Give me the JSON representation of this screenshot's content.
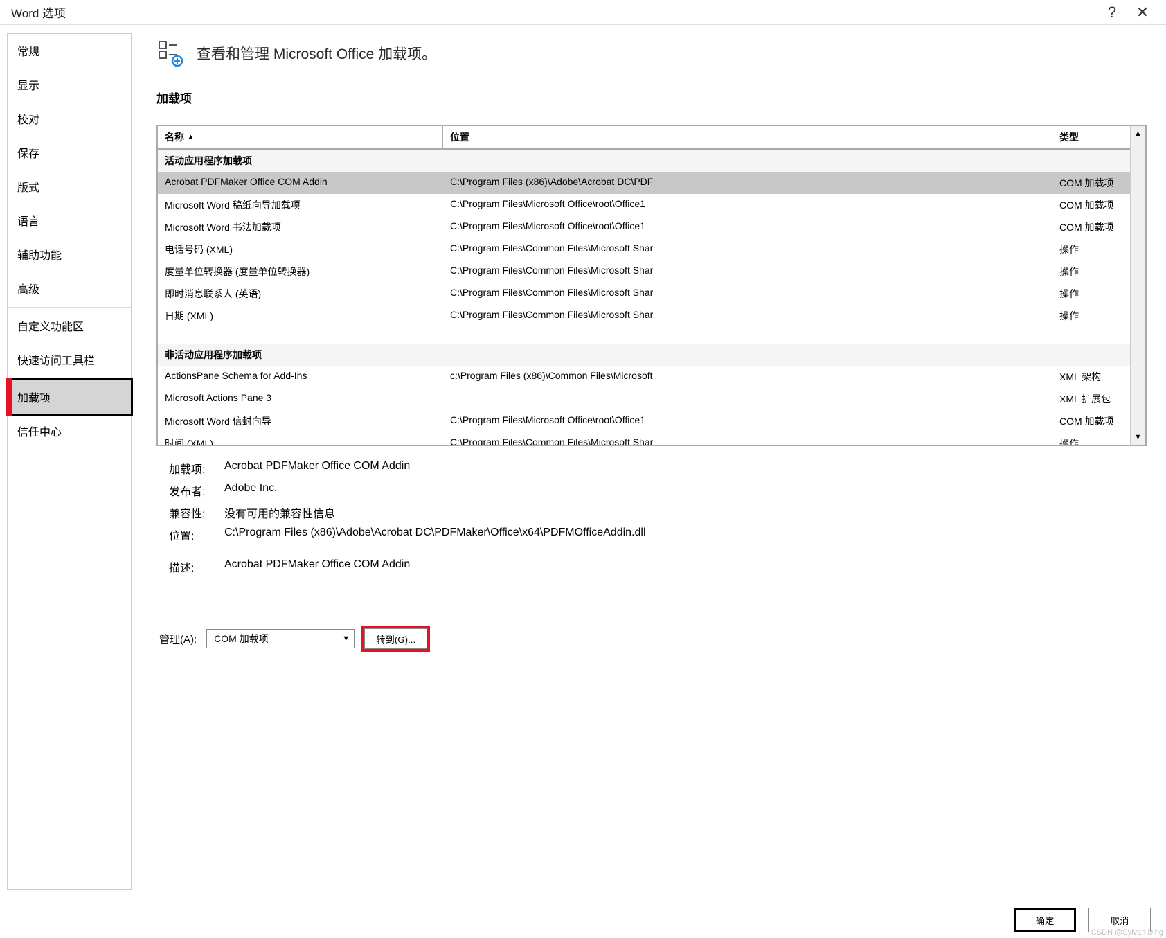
{
  "titlebar": {
    "title": "Word 选项",
    "help": "?",
    "close": "✕"
  },
  "sidebar": {
    "items": [
      "常规",
      "显示",
      "校对",
      "保存",
      "版式",
      "语言",
      "辅助功能",
      "高级"
    ],
    "items2": [
      "自定义功能区",
      "快速访问工具栏"
    ],
    "items3": [
      "加载项",
      "信任中心"
    ],
    "selected": "加载项"
  },
  "header": {
    "text": "查看和管理 Microsoft Office 加载项。"
  },
  "section_title": "加载项",
  "table": {
    "headers": {
      "name": "名称",
      "loc": "位置",
      "type": "类型"
    },
    "group1": "活动应用程序加载项",
    "group2": "非活动应用程序加载项",
    "rows1": [
      {
        "name": "Acrobat PDFMaker Office COM Addin",
        "loc": "C:\\Program Files (x86)\\Adobe\\Acrobat DC\\PDF",
        "type": "COM 加载项",
        "selected": true
      },
      {
        "name": "Microsoft Word 稿纸向导加载项",
        "loc": "C:\\Program Files\\Microsoft Office\\root\\Office1",
        "type": "COM 加载项"
      },
      {
        "name": "Microsoft Word 书法加载项",
        "loc": "C:\\Program Files\\Microsoft Office\\root\\Office1",
        "type": "COM 加载项"
      },
      {
        "name": "电话号码 (XML)",
        "loc": "C:\\Program Files\\Common Files\\Microsoft Shar",
        "type": "操作"
      },
      {
        "name": "度量单位转换器 (度量单位转换器)",
        "loc": "C:\\Program Files\\Common Files\\Microsoft Shar",
        "type": "操作"
      },
      {
        "name": "即时消息联系人 (英语)",
        "loc": "C:\\Program Files\\Common Files\\Microsoft Shar",
        "type": "操作"
      },
      {
        "name": "日期 (XML)",
        "loc": "C:\\Program Files\\Common Files\\Microsoft Shar",
        "type": "操作"
      }
    ],
    "rows2": [
      {
        "name": "ActionsPane Schema for Add-Ins",
        "loc": "c:\\Program Files (x86)\\Common Files\\Microsoft",
        "type": "XML 架构"
      },
      {
        "name": "Microsoft Actions Pane 3",
        "loc": "",
        "type": "XML 扩展包"
      },
      {
        "name": "Microsoft Word 信封向导",
        "loc": "C:\\Program Files\\Microsoft Office\\root\\Office1",
        "type": "COM 加载项"
      },
      {
        "name": "时间 (XML)",
        "loc": "C:\\Program Files\\Common Files\\Microsoft Shar",
        "type": "操作"
      }
    ]
  },
  "details": {
    "labels": {
      "addin": "加载项:",
      "publisher": "发布者:",
      "compat": "兼容性:",
      "loc": "位置:",
      "desc": "描述:"
    },
    "values": {
      "addin": "Acrobat PDFMaker Office COM Addin",
      "publisher": "Adobe Inc.",
      "compat": "没有可用的兼容性信息",
      "loc": "C:\\Program Files (x86)\\Adobe\\Acrobat DC\\PDFMaker\\Office\\x64\\PDFMOfficeAddin.dll",
      "desc": "Acrobat PDFMaker Office COM Addin"
    }
  },
  "manage": {
    "label": "管理(A):",
    "selected": "COM 加载项",
    "goto": "转到(G)..."
  },
  "footer": {
    "ok": "确定",
    "cancel": "取消"
  },
  "watermark": "CSDN @Sylvan Ding"
}
